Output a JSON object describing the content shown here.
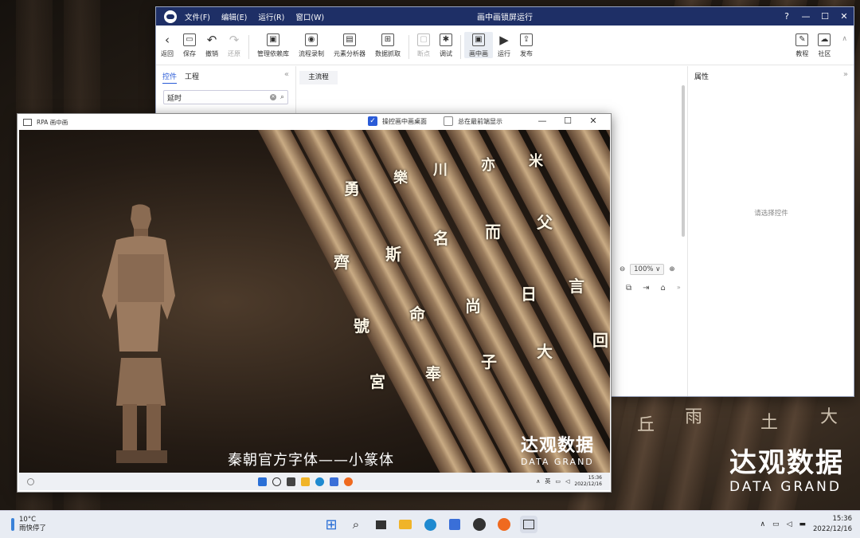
{
  "ide": {
    "menu": [
      "文件(F)",
      "编辑(E)",
      "运行(R)",
      "窗口(W)"
    ],
    "title": "画中画锁屏运行",
    "window_controls": [
      "?",
      "—",
      "☐",
      "✕"
    ],
    "toolbar": [
      {
        "label": "返回",
        "icon": "back-icon",
        "glyph": "‹"
      },
      {
        "label": "保存",
        "icon": "save-icon",
        "glyph": "▭"
      },
      {
        "label": "撤销",
        "icon": "undo-icon",
        "glyph": "↶"
      },
      {
        "label": "还原",
        "icon": "redo-icon",
        "glyph": "↷",
        "disabled": true
      },
      {
        "label": "管理依赖库",
        "icon": "dependency-icon",
        "glyph": "▣"
      },
      {
        "label": "流程录制",
        "icon": "record-icon",
        "glyph": "◉"
      },
      {
        "label": "元素分析器",
        "icon": "element-analyzer-icon",
        "glyph": "▤"
      },
      {
        "label": "数据抓取",
        "icon": "data-capture-icon",
        "glyph": "⊞"
      },
      {
        "label": "断点",
        "icon": "breakpoint-icon",
        "glyph": "▢",
        "disabled": true
      },
      {
        "label": "调试",
        "icon": "debug-icon",
        "glyph": "✱"
      },
      {
        "label": "画中画",
        "icon": "pip-icon",
        "glyph": "▣",
        "active": true
      },
      {
        "label": "运行",
        "icon": "run-icon",
        "glyph": "▶"
      },
      {
        "label": "发布",
        "icon": "publish-icon",
        "glyph": "⇪"
      }
    ],
    "toolbar_right": [
      {
        "label": "教程",
        "icon": "tutorial-icon",
        "glyph": "✎"
      },
      {
        "label": "社区",
        "icon": "community-icon",
        "glyph": "☁"
      }
    ],
    "left_tabs": [
      "控件",
      "工程"
    ],
    "search_value": "延时",
    "flow_tab": "主流程",
    "zoom": "100%",
    "properties_title": "属性",
    "properties_empty": "请选择控件"
  },
  "pip": {
    "title": "RPA 画中画",
    "option_operate": "操控画中画桌面",
    "option_operate_checked": true,
    "option_top": "总在最前端显示",
    "option_top_checked": false,
    "controls": [
      "—",
      "☐",
      "✕"
    ],
    "subtitle": "秦朝官方字体——小篆体",
    "brand_cn": "达观数据",
    "brand_en": "DATA GRAND",
    "tray_lang": "英",
    "tray_time": "15:36",
    "tray_date": "2022/12/16"
  },
  "background": {
    "brand_cn": "达观数据",
    "brand_en": "DATA GRAND"
  },
  "taskbar": {
    "weather_temp": "10°C",
    "weather_desc": "雨快停了",
    "time": "15:36",
    "date": "2022/12/16"
  }
}
